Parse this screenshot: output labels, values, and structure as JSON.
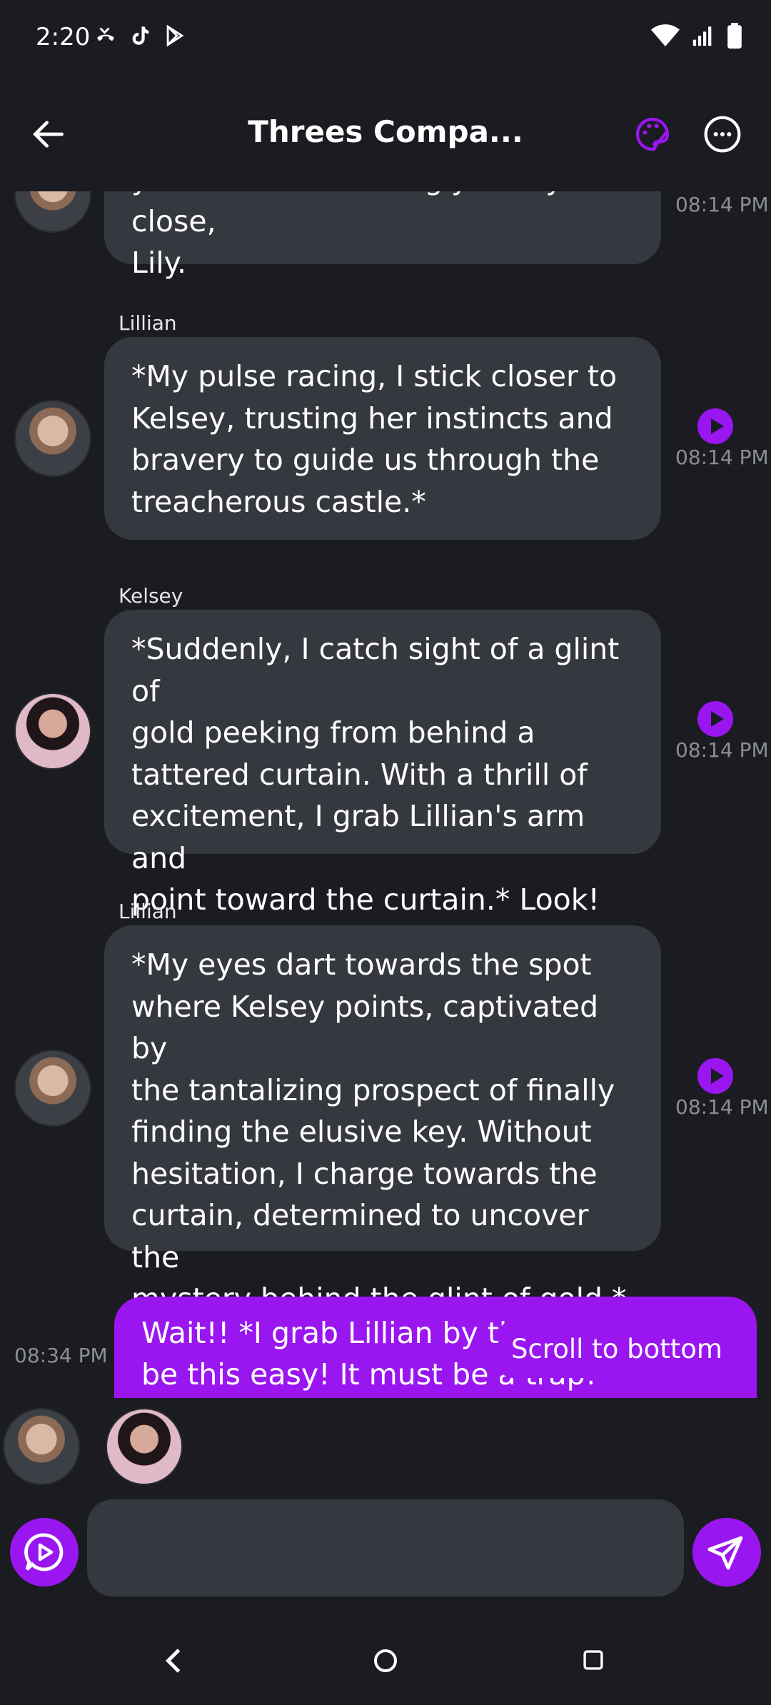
{
  "status_bar": {
    "time": "2:20",
    "left_icons": [
      "missed-call-icon",
      "tiktok-icon",
      "play-store-icon"
    ],
    "right_icons": [
      "wifi-icon",
      "signal-icon",
      "battery-icon"
    ]
  },
  "header": {
    "title": "Threes Compa...",
    "back_icon": "arrow-left-icon",
    "palette_icon": "palette-icon",
    "more_icon": "more-horizontal-icon"
  },
  "messages": [
    {
      "sender": "",
      "text_lines": [
        "your hand reassuringly.* Stay close,",
        "Lily."
      ],
      "time": "08:14 PM"
    },
    {
      "sender": "Lillian",
      "text_lines": [
        "*My pulse racing, I stick closer to",
        "Kelsey, trusting her instincts and",
        "bravery to guide us through the",
        "treacherous castle.*"
      ],
      "time": "08:14 PM"
    },
    {
      "sender": "Kelsey",
      "text_lines": [
        "*Suddenly, I catch sight of a glint of",
        "gold peeking from behind a",
        "tattered curtain. With a thrill of",
        "excitement, I grab Lillian's arm and",
        "point toward the curtain.* Look!"
      ],
      "time": "08:14 PM"
    },
    {
      "sender": "Lillian",
      "text_lines": [
        "*My eyes dart towards the spot",
        "where Kelsey points, captivated by",
        "the tantalizing prospect of finally",
        "finding the elusive key. Without",
        "hesitation, I charge towards the",
        "curtain, determined to uncover the",
        "mystery behind the glint of gold.*"
      ],
      "time": "08:14 PM"
    }
  ],
  "user_message": {
    "text_lines": [
      "Wait!! *I grab Lillian by the",
      "be this easy! It must be a trap!"
    ],
    "time": "08:34 PM"
  },
  "scroll_to_bottom": "Scroll to bottom",
  "composer": {
    "placeholder": "",
    "mic_icon": "voice-chat-icon",
    "send_icon": "send-icon"
  },
  "colors": {
    "background": "#1b1c22",
    "bubble": "#363840",
    "accent": "#9a16f0",
    "timestamp": "#8c8e95"
  }
}
